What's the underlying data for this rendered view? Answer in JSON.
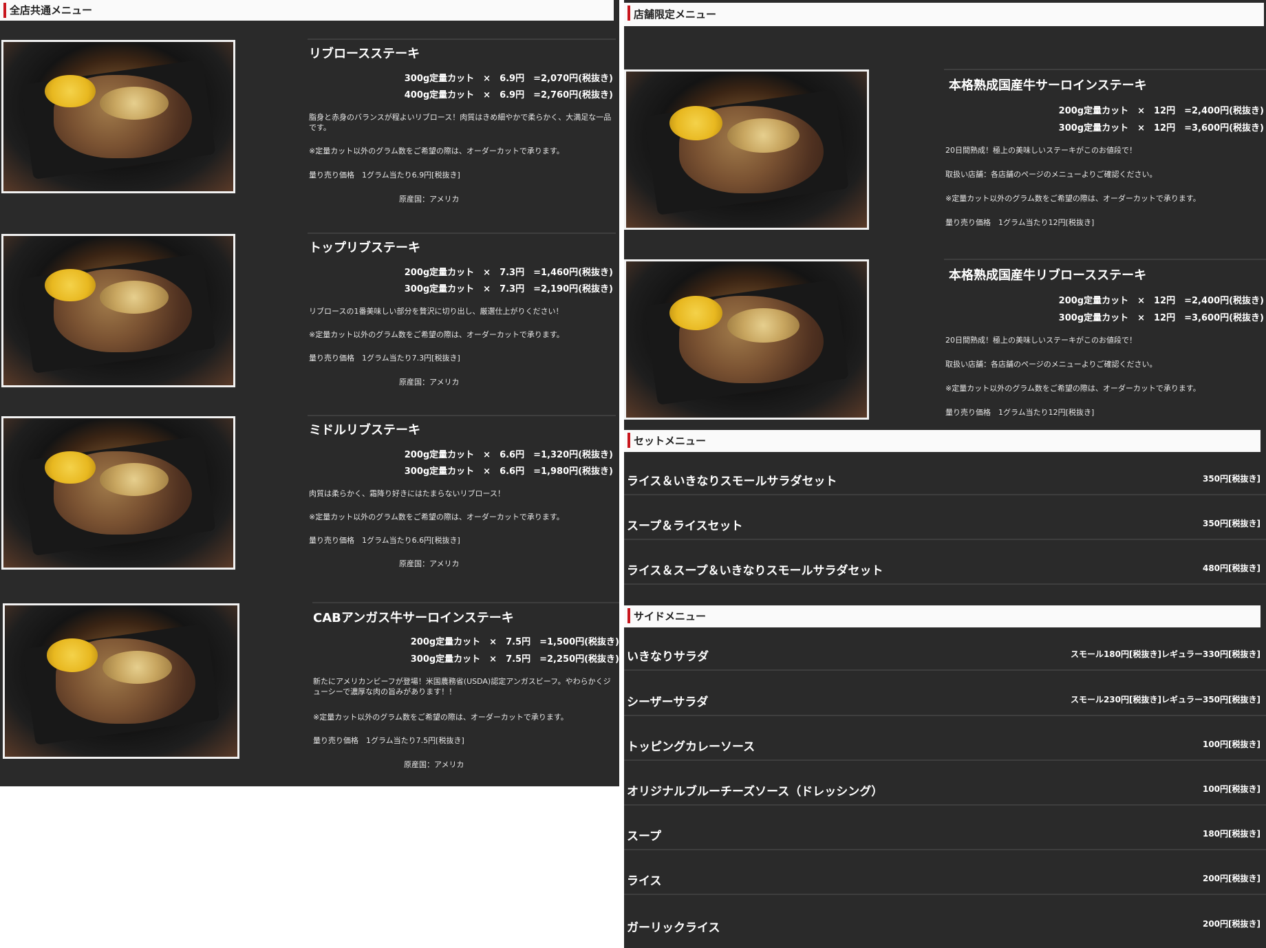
{
  "left": {
    "header": "全店共通メニュー",
    "items": [
      {
        "title": "リブロースステーキ",
        "prices": [
          "300g定量カット　×　6.9円　=2,070円(税抜き)",
          "400g定量カット　×　6.9円　=2,760円(税抜き)"
        ],
        "desc": "脂身と赤身のバランスが程よいリブロース！肉質はきめ細やかで柔らかく、大満足な一品です。",
        "note": "※定量カット以外のグラム数をご希望の際は、オーダーカットで承ります。",
        "unit": "量り売り価格　1グラム当たり6.9円[税抜き]",
        "origin": "原産国：アメリカ"
      },
      {
        "title": "トップリブステーキ",
        "prices": [
          "200g定量カット　×　7.3円　=1,460円(税抜き)",
          "300g定量カット　×　7.3円　=2,190円(税抜き)"
        ],
        "desc": "リブロースの1番美味しい部分を贅沢に切り出し、厳選仕上がりください！",
        "note": "※定量カット以外のグラム数をご希望の際は、オーダーカットで承ります。",
        "unit": "量り売り価格　1グラム当たり7.3円[税抜き]",
        "origin": "原産国：アメリカ"
      },
      {
        "title": "ミドルリブステーキ",
        "prices": [
          "200g定量カット　×　6.6円　=1,320円(税抜き)",
          "300g定量カット　×　6.6円　=1,980円(税抜き)"
        ],
        "desc": "肉質は柔らかく、霜降り好きにはたまらないリブロース！",
        "note": "※定量カット以外のグラム数をご希望の際は、オーダーカットで承ります。",
        "unit": "量り売り価格　1グラム当たり6.6円[税抜き]",
        "origin": "原産国：アメリカ"
      },
      {
        "title": "CABアンガス牛サーロインステーキ",
        "prices": [
          "200g定量カット　×　7.5円　=1,500円(税抜き)",
          "300g定量カット　×　7.5円　=2,250円(税抜き)"
        ],
        "desc": "新たにアメリカンビーフが登場！米国農務省(USDA)認定アンガスビーフ。やわらかくジューシーで濃厚な肉の旨みがあります！！",
        "note": "※定量カット以外のグラム数をご希望の際は、オーダーカットで承ります。",
        "unit": "量り売り価格　1グラム当たり7.5円[税抜き]",
        "origin": "原産国：アメリカ"
      }
    ]
  },
  "right": {
    "header": "店舗限定メニュー",
    "items": [
      {
        "title": "本格熟成国産牛サーロインステーキ",
        "prices": [
          "200g定量カット　×　12円　=2,400円(税抜き)",
          "300g定量カット　×　12円　=3,600円(税抜き)"
        ],
        "desc": "20日間熟成！極上の美味しいステーキがこのお値段で！",
        "shops": "取扱い店舗：各店舗のページのメニューよりご確認ください。",
        "note": "※定量カット以外のグラム数をご希望の際は、オーダーカットで承ります。",
        "unit": "量り売り価格　1グラム当たり12円[税抜き]"
      },
      {
        "title": "本格熟成国産牛リブロースステーキ",
        "prices": [
          "200g定量カット　×　12円　=2,400円(税抜き)",
          "300g定量カット　×　12円　=3,600円(税抜き)"
        ],
        "desc": "20日間熟成！極上の美味しいステーキがこのお値段で！",
        "shops": "取扱い店舗：各店舗のページのメニューよりご確認ください。",
        "note": "※定量カット以外のグラム数をご希望の際は、オーダーカットで承ります。",
        "unit": "量り売り価格　1グラム当たり12円[税抜き]"
      }
    ],
    "set_header": "セットメニュー",
    "set_items": [
      {
        "name": "ライス＆いきなりスモールサラダセット",
        "price": "350円[税抜き]"
      },
      {
        "name": "スープ＆ライスセット",
        "price": "350円[税抜き]"
      },
      {
        "name": "ライス＆スープ＆いきなりスモールサラダセット",
        "price": "480円[税抜き]"
      }
    ],
    "side_header": "サイドメニュー",
    "side_items": [
      {
        "name": "いきなりサラダ",
        "price": "スモール180円[税抜き]レギュラー330円[税抜き]"
      },
      {
        "name": "シーザーサラダ",
        "price": "スモール230円[税抜き]レギュラー350円[税抜き]"
      },
      {
        "name": "トッピングカレーソース",
        "price": "100円[税抜き]"
      },
      {
        "name": "オリジナルブルーチーズソース（ドレッシング）",
        "price": "100円[税抜き]"
      },
      {
        "name": "スープ",
        "price": "180円[税抜き]"
      },
      {
        "name": "ライス",
        "price": "200円[税抜き]"
      },
      {
        "name": "ガーリックライス",
        "price": "200円[税抜き]"
      }
    ]
  }
}
